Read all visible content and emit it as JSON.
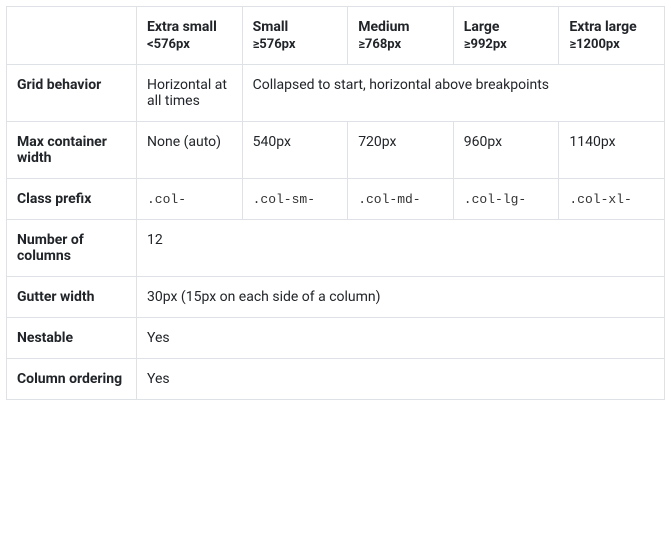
{
  "columns": [
    {
      "title": "Extra small",
      "sub": "<576px"
    },
    {
      "title": "Small",
      "sub": "≥576px"
    },
    {
      "title": "Medium",
      "sub": "≥768px"
    },
    {
      "title": "Large",
      "sub": "≥992px"
    },
    {
      "title": "Extra large",
      "sub": "≥1200px"
    }
  ],
  "rows": {
    "grid_behavior": {
      "label": "Grid behavior",
      "xs": "Horizontal at all times",
      "rest": "Collapsed to start, horizontal above breakpoints"
    },
    "max_container_width": {
      "label": "Max container width",
      "xs": "None (auto)",
      "sm": "540px",
      "md": "720px",
      "lg": "960px",
      "xl": "1140px"
    },
    "class_prefix": {
      "label": "Class prefix",
      "xs": ".col-",
      "sm": ".col-sm-",
      "md": ".col-md-",
      "lg": ".col-lg-",
      "xl": ".col-xl-"
    },
    "num_columns": {
      "label": "Number of columns",
      "value": "12"
    },
    "gutter_width": {
      "label": "Gutter width",
      "value": "30px (15px on each side of a column)"
    },
    "nestable": {
      "label": "Nestable",
      "value": "Yes"
    },
    "column_ordering": {
      "label": "Column ordering",
      "value": "Yes"
    }
  }
}
